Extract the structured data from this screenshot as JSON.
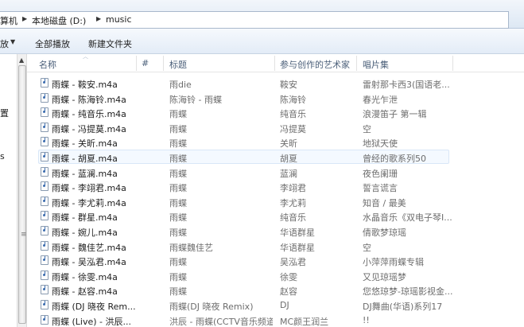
{
  "breadcrumb": {
    "items": [
      "算机",
      "本地磁盘 (D:)",
      "music"
    ]
  },
  "toolbar": {
    "left_cut": "放",
    "play_all": "全部播放",
    "new_folder": "新建文件夹"
  },
  "nav": {
    "items": [
      "置",
      "s"
    ]
  },
  "columns": {
    "name": "名称",
    "number": "#",
    "title": "标题",
    "artists": "参与创作的艺术家",
    "album": "唱片集"
  },
  "rows": [
    {
      "name": "雨蝶 - 鞍安.m4a",
      "title": "雨die",
      "artist": "鞍安",
      "album": "雷射那卡西3(国语老..."
    },
    {
      "name": "雨蝶 - 陈海铃.m4a",
      "title": "陈海铃 - 雨蝶",
      "artist": "陈海铃",
      "album": "春光乍泄"
    },
    {
      "name": "雨蝶 - 纯音乐.m4a",
      "title": "雨蝶",
      "artist": "纯音乐",
      "album": "浪漫笛子 第一辑"
    },
    {
      "name": "雨蝶 - 冯提莫.m4a",
      "title": "雨蝶",
      "artist": "冯提莫",
      "album": "空"
    },
    {
      "name": "雨蝶 - 关昕.m4a",
      "title": "雨蝶",
      "artist": "关昕",
      "album": "地狱天使"
    },
    {
      "name": "雨蝶 - 胡夏.m4a",
      "title": "雨蝶",
      "artist": "胡夏",
      "album": "曾经的歌系列50"
    },
    {
      "name": "雨蝶 - 蓝澜.m4a",
      "title": "雨蝶",
      "artist": "蓝澜",
      "album": "夜色阑珊"
    },
    {
      "name": "雨蝶 - 李翊君.m4a",
      "title": "雨蝶",
      "artist": "李翊君",
      "album": "誓言谎言"
    },
    {
      "name": "雨蝶 - 李尤莉.m4a",
      "title": "雨蝶",
      "artist": "李尤莉",
      "album": "知音 / 最美"
    },
    {
      "name": "雨蝶 - 群星.m4a",
      "title": "雨蝶",
      "artist": "纯音乐",
      "album": "水晶音乐《双电子琴I..."
    },
    {
      "name": "雨蝶 - 婉儿.m4a",
      "title": "雨蝶",
      "artist": "华语群星",
      "album": "倩歌梦琼瑶"
    },
    {
      "name": "雨蝶 - 魏佳艺.m4a",
      "title": "雨蝶魏佳艺",
      "artist": "华语群星",
      "album": "空"
    },
    {
      "name": "雨蝶 - 吴泓君.m4a",
      "title": "雨蝶",
      "artist": "吴泓君",
      "album": "小萍萍雨蝶专辑"
    },
    {
      "name": "雨蝶 - 徐雯.m4a",
      "title": "雨蝶",
      "artist": "徐雯",
      "album": "又见琼瑶梦"
    },
    {
      "name": "雨蝶 - 赵容.m4a",
      "title": "雨蝶",
      "artist": "赵容",
      "album": "您悠琼梦-琼瑶影视金..."
    },
    {
      "name": "雨蝶 (DJ 晓夜 Rem...",
      "title": "雨蝶(DJ 晓夜 Remix)",
      "artist": "DJ",
      "album": "DJ舞曲(华语)系列17"
    },
    {
      "name": "雨蝶 (Live) - 洪辰...",
      "title": "洪辰 - 雨蝶(CCTV音乐频道)",
      "artist": "MC颜王润兰",
      "album": "!!"
    }
  ],
  "selected_row_index": 5
}
